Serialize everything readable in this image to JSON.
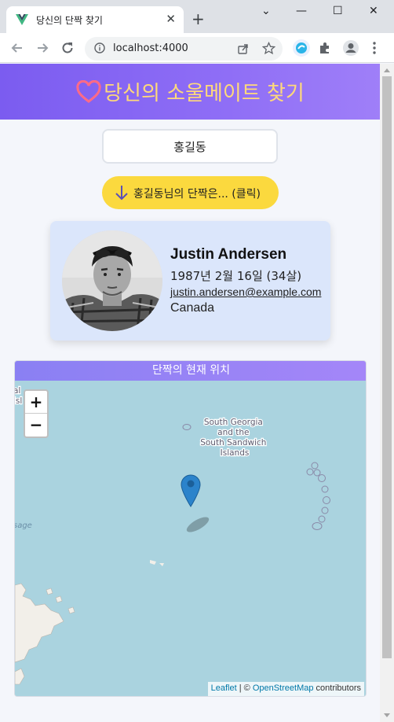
{
  "browser": {
    "tab_title": "당신의 단짝 찾기",
    "tab_close": "✕",
    "new_tab": "+",
    "url": "localhost:4000",
    "window_controls": {
      "collapse": "⌄",
      "minimize": "—",
      "maximize": "☐",
      "close": "✕"
    }
  },
  "header": {
    "title": "당신의 소울메이트 찾기",
    "heart_color": "#ff6b86",
    "title_color": "#ffd97a"
  },
  "form": {
    "name_value": "홍길동"
  },
  "reveal_button": {
    "label": "홍길동님의 단짝은... (클릭)",
    "color": "#fbd93e"
  },
  "profile": {
    "name": "Justin Andersen",
    "birth": "1987년 2월 16일 (34살)",
    "email": "justin.andersen@example.com",
    "country": "Canada"
  },
  "map": {
    "title": "단짝의 현재 위치",
    "zoom_in": "+",
    "zoom_out": "−",
    "place_label_lines": [
      "South Georgia",
      "and the",
      "South Sandwich",
      "Islands"
    ],
    "edge_label_left": "sage",
    "edge_label_top": [
      "al",
      "isl"
    ],
    "attribution": {
      "leaflet": "Leaflet",
      "separator": " | © ",
      "osm": "OpenStreetMap",
      "suffix": " contributors"
    },
    "water_color": "#aad3df",
    "marker_color": "#2b83cb"
  }
}
